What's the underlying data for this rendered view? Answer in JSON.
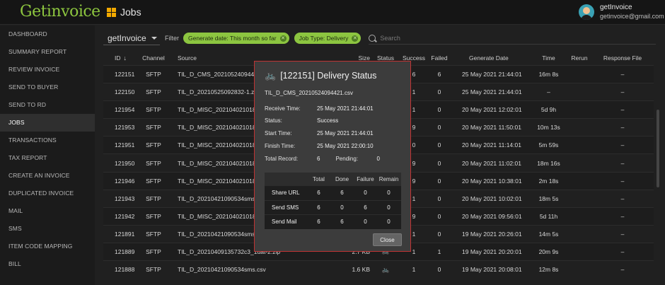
{
  "app": {
    "logo": "Getinvoice",
    "page_title": "Jobs"
  },
  "user": {
    "name": "getInvoice",
    "email": "getinvoice@gmail.com"
  },
  "sidebar": {
    "items": [
      {
        "label": "DASHBOARD"
      },
      {
        "label": "SUMMARY REPORT"
      },
      {
        "label": "REVIEW INVOICE"
      },
      {
        "label": "SEND TO BUYER"
      },
      {
        "label": "SEND TO RD"
      },
      {
        "label": "JOBS",
        "active": true
      },
      {
        "label": "TRANSACTIONS"
      },
      {
        "label": "TAX REPORT"
      },
      {
        "label": "CREATE AN INVOICE"
      },
      {
        "label": "DUPLICATED INVOICE"
      },
      {
        "label": "MAIL"
      },
      {
        "label": "SMS"
      },
      {
        "label": "ITEM CODE MAPPING"
      },
      {
        "label": "BILL"
      }
    ]
  },
  "filters": {
    "select_value": "getInvoice",
    "label": "Filter",
    "chips": [
      "Generate date: This month so far",
      "Job Type: Delivery"
    ],
    "search_placeholder": "Search"
  },
  "table": {
    "headers": [
      "ID",
      "Channel",
      "Source",
      "Size",
      "Status",
      "Success",
      "Failed",
      "Generate Date",
      "Time",
      "Rerun",
      "Response File"
    ],
    "rows": [
      {
        "id": "122151",
        "channel": "SFTP",
        "source": "TIL_D_CMS_20210524094421.csv",
        "size": "",
        "status": "",
        "success": "6",
        "failed": "6",
        "date": "25 May 2021 21:44:01",
        "time": "16m 8s",
        "rerun": "",
        "resp": "–"
      },
      {
        "id": "122150",
        "channel": "SFTP",
        "source": "TIL_D_20210525092832-1.zip",
        "size": "",
        "status": "",
        "success": "1",
        "failed": "0",
        "date": "25 May 2021 21:44:01",
        "time": "–",
        "rerun": "",
        "resp": "–"
      },
      {
        "id": "121954",
        "channel": "SFTP",
        "source": "TIL_D_MISC_20210402101830.zip",
        "size": "",
        "status": "",
        "success": "1",
        "failed": "0",
        "date": "20 May 2021 12:02:01",
        "time": "5d 9h",
        "rerun": "",
        "resp": "–"
      },
      {
        "id": "121953",
        "channel": "SFTP",
        "source": "TIL_D_MISC_20210402101830.zip",
        "size": "",
        "status": "",
        "success": "9",
        "failed": "0",
        "date": "20 May 2021 11:50:01",
        "time": "10m 13s",
        "rerun": "",
        "resp": "–"
      },
      {
        "id": "121951",
        "channel": "SFTP",
        "source": "TIL_D_MISC_20210402101830.zip",
        "size": "",
        "status": "",
        "success": "0",
        "failed": "0",
        "date": "20 May 2021 11:14:01",
        "time": "5m 59s",
        "rerun": "",
        "resp": "–"
      },
      {
        "id": "121950",
        "channel": "SFTP",
        "source": "TIL_D_MISC_20210402101830.zip",
        "size": "",
        "status": "",
        "success": "9",
        "failed": "0",
        "date": "20 May 2021 11:02:01",
        "time": "18m 16s",
        "rerun": "",
        "resp": "–"
      },
      {
        "id": "121946",
        "channel": "SFTP",
        "source": "TIL_D_MISC_20210402101830.zip",
        "size": "",
        "status": "",
        "success": "9",
        "failed": "0",
        "date": "20 May 2021 10:38:01",
        "time": "2m 18s",
        "rerun": "",
        "resp": "–"
      },
      {
        "id": "121943",
        "channel": "SFTP",
        "source": "TIL_D_20210421090534sms.csv",
        "size": "",
        "status": "",
        "success": "1",
        "failed": "0",
        "date": "20 May 2021 10:02:01",
        "time": "18m 5s",
        "rerun": "",
        "resp": "–"
      },
      {
        "id": "121942",
        "channel": "SFTP",
        "source": "TIL_D_MISC_20210402101830.zip",
        "size": "",
        "status": "",
        "success": "9",
        "failed": "0",
        "date": "20 May 2021 09:56:01",
        "time": "5d 11h",
        "rerun": "",
        "resp": "–"
      },
      {
        "id": "121891",
        "channel": "SFTP",
        "source": "TIL_D_20210421090534sms.csv",
        "size": "",
        "status": "",
        "success": "1",
        "failed": "0",
        "date": "19 May 2021 20:26:01",
        "time": "14m 5s",
        "rerun": "",
        "resp": "–"
      },
      {
        "id": "121889",
        "channel": "SFTP",
        "source": "TIL_D_20210409135732c3_1uat-2.zip",
        "size": "2.7 KB",
        "status": "bike-icon",
        "success": "1",
        "failed": "1",
        "date": "19 May 2021 20:20:01",
        "time": "20m 9s",
        "rerun": "",
        "resp": "–"
      },
      {
        "id": "121888",
        "channel": "SFTP",
        "source": "TIL_D_20210421090534sms.csv",
        "size": "1.6 KB",
        "status": "bike-icon",
        "success": "1",
        "failed": "0",
        "date": "19 May 2021 20:08:01",
        "time": "12m 8s",
        "rerun": "",
        "resp": "–"
      }
    ]
  },
  "modal": {
    "title": "[122151] Delivery Status",
    "file": "TIL_D_CMS_20210524094421.csv",
    "receive_label": "Receive Time:",
    "receive_value": "25 May 2021 21:44:01",
    "status_label": "Status:",
    "status_value": "Success",
    "start_label": "Start Time:",
    "start_value": "25 May 2021 21:44:01",
    "finish_label": "Finish Time:",
    "finish_value": "25 May 2021 22:00:10",
    "total_label": "Total Record:",
    "total_value": "6",
    "pending_label": "Pending:",
    "pending_value": "0",
    "stats_headers": [
      "Total",
      "Done",
      "Failure",
      "Remain"
    ],
    "stats_rows": [
      {
        "label": "Share URL",
        "total": "6",
        "done": "6",
        "failure": "0",
        "remain": "0"
      },
      {
        "label": "Send SMS",
        "total": "6",
        "done": "0",
        "failure": "6",
        "remain": "0"
      },
      {
        "label": "Send Mail",
        "total": "6",
        "done": "6",
        "failure": "0",
        "remain": "0"
      }
    ],
    "close_label": "Close"
  },
  "colors": {
    "accent": "#8cc540",
    "highlight": "#f2b400",
    "modal_border": "#c03333"
  }
}
